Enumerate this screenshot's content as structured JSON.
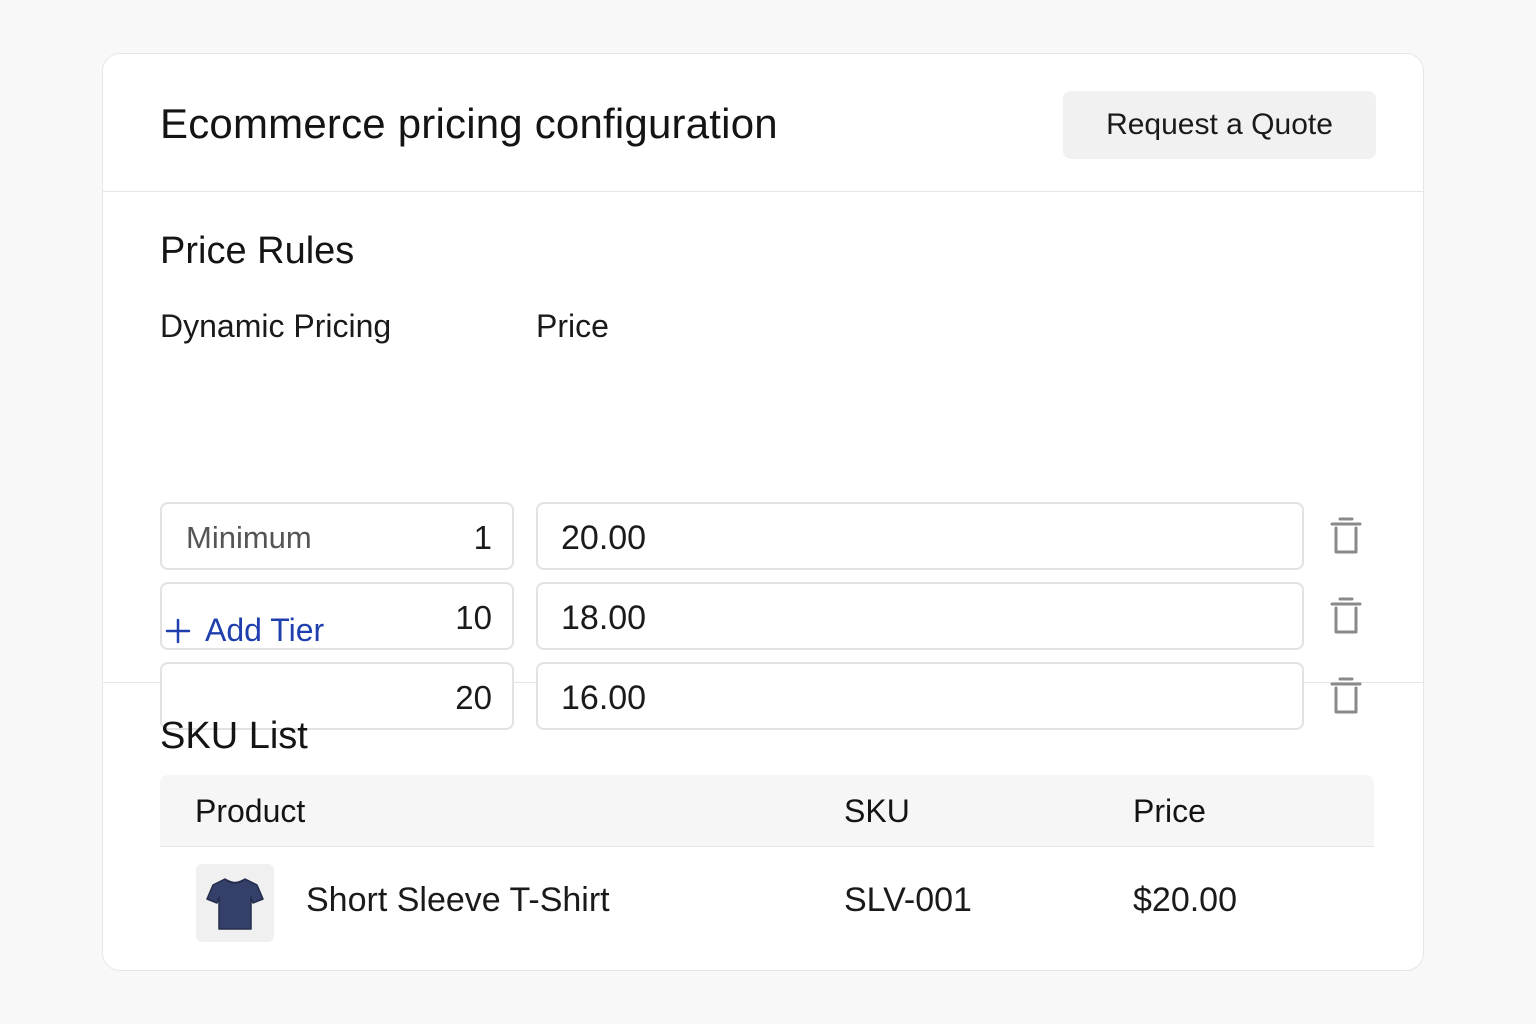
{
  "header": {
    "title": "Ecommerce pricing configuration",
    "quote_button": "Request a Quote"
  },
  "price_rules": {
    "title": "Price Rules",
    "col_quantity": "Dynamic Pricing",
    "col_price": "Price",
    "tiers": [
      {
        "placeholder": "Minimum",
        "quantity": "1",
        "price": "20.00"
      },
      {
        "placeholder": "",
        "quantity": "10",
        "price": "18.00"
      },
      {
        "placeholder": "",
        "quantity": "20",
        "price": "16.00"
      }
    ],
    "add_tier_label": "Add Tier",
    "accent_color": "#1f3fae"
  },
  "sku_list": {
    "title": "SKU List",
    "columns": [
      "Product",
      "SKU",
      "Price"
    ],
    "rows": [
      {
        "thumbnail_icon": "tshirt-icon",
        "product": "Short Sleeve T-Shirt",
        "sku": "SLV-001",
        "price": "$20.00"
      }
    ]
  },
  "icons": {
    "delete": "trash-icon",
    "add": "plus-icon"
  }
}
